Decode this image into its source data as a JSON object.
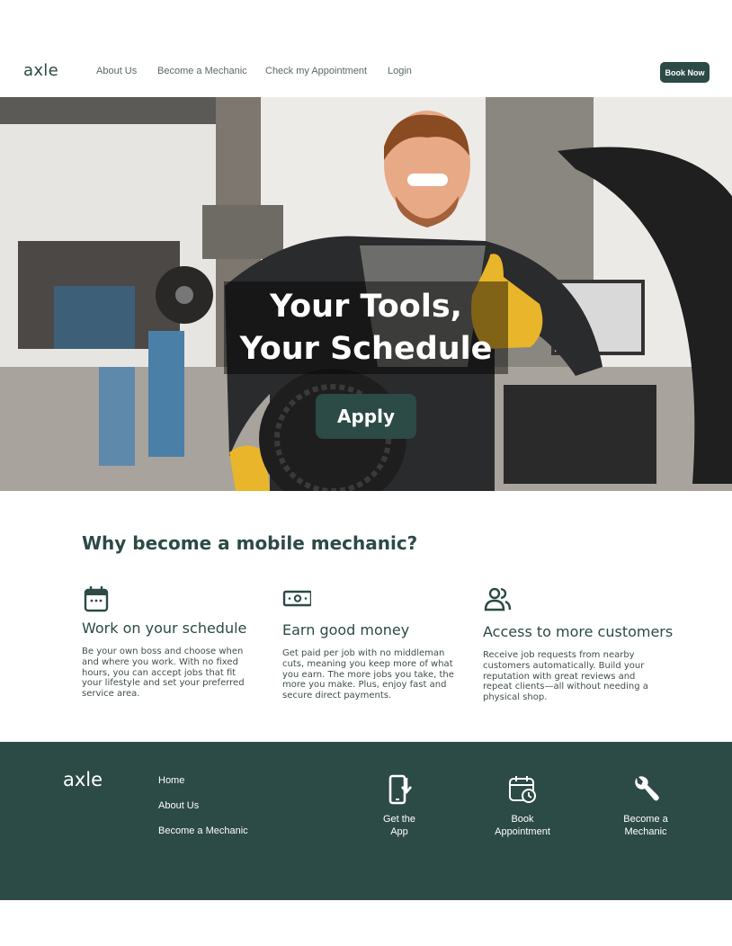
{
  "brand": {
    "logo": "axle"
  },
  "nav": {
    "items": [
      {
        "label": "About Us"
      },
      {
        "label": "Become a Mechanic"
      },
      {
        "label": "Check my Appointment"
      },
      {
        "label": "Login"
      }
    ],
    "cta": "Book Now"
  },
  "hero": {
    "title_line1": "Your Tools,",
    "title_line2": "Your Schedule",
    "cta": "Apply",
    "image": "mechanic-holding-tire-thumbs-up"
  },
  "why": {
    "title": "Why become a mobile mechanic?",
    "features": [
      {
        "icon": "calendar-icon",
        "title": "Work on your schedule",
        "description": "Be your own boss and choose when and where you work. With no fixed hours, you can accept jobs that fit your lifestyle and set your preferred service area."
      },
      {
        "icon": "money-icon",
        "title": "Earn good money",
        "description": "Get paid per job with no middleman cuts, meaning you keep more of what you earn. The more jobs you take, the more you make. Plus, enjoy fast and secure direct payments."
      },
      {
        "icon": "customers-icon",
        "title": "Access to more customers",
        "description": "Receive job requests from nearby customers automatically. Build your reputation with great reviews and repeat clients—all without needing a physical shop."
      }
    ]
  },
  "footer": {
    "logo": "axle",
    "links": [
      {
        "label": "Home"
      },
      {
        "label": "About Us"
      },
      {
        "label": "Become a Mechanic"
      }
    ],
    "actions": [
      {
        "icon": "phone-download-icon",
        "line1": "Get the",
        "line2": "App"
      },
      {
        "icon": "calendar-clock-icon",
        "line1": "Book",
        "line2": "Appointment"
      },
      {
        "icon": "wrench-icon",
        "line1": "Become a",
        "line2": "Mechanic"
      }
    ]
  },
  "colors": {
    "primary": "#2c4a46",
    "text_muted": "#5a6a68",
    "white": "#ffffff"
  }
}
